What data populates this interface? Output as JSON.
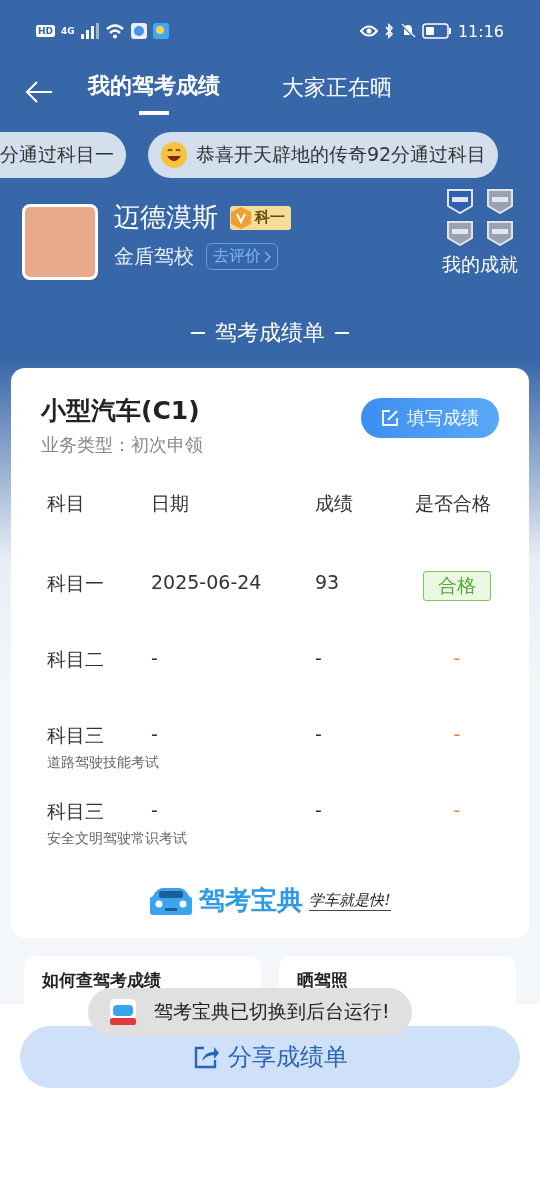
{
  "status_bar": {
    "time": "11:16",
    "hd": "HD",
    "network": "4G"
  },
  "tabs": [
    {
      "label": "我的驾考成绩",
      "selected": true
    },
    {
      "label": "大家正在晒",
      "selected": false
    }
  ],
  "ticker": [
    {
      "text": "分通过科目一",
      "emoji": false
    },
    {
      "text": "恭喜开天辟地的传奇92分通过科目",
      "emoji": true
    }
  ],
  "profile": {
    "name": "迈德漠斯",
    "badge": "科一",
    "school": "金盾驾校",
    "review_link": "去评价",
    "achievements_label": "我的成就",
    "achievements": [
      {
        "earned": true
      },
      {
        "earned": false
      },
      {
        "earned": false
      },
      {
        "earned": false
      }
    ]
  },
  "section_title": "驾考成绩单",
  "report": {
    "vehicle": "小型汽车(C1)",
    "business_type": "业务类型：初次申领",
    "fill_button": "填写成绩",
    "columns": [
      "科目",
      "日期",
      "成绩",
      "是否合格"
    ],
    "rows": [
      {
        "subject": "科目一",
        "note": "",
        "date": "2025-06-24",
        "score": "93",
        "result": "合格",
        "passed": true
      },
      {
        "subject": "科目二",
        "date": "-",
        "score": "-",
        "result": "-",
        "passed": false
      },
      {
        "subject": "科目三",
        "note": "道路驾驶技能考试",
        "date": "-",
        "score": "-",
        "result": "-",
        "passed": false
      },
      {
        "subject": "科目三",
        "note": "安全文明驾驶常识考试",
        "date": "-",
        "score": "-",
        "result": "-",
        "passed": false
      }
    ],
    "brand": "驾考宝典",
    "slogan": "学车就是快!"
  },
  "promo_cards": [
    {
      "title": "如何查驾考成绩"
    },
    {
      "title": "晒驾照"
    }
  ],
  "share_button": "分享成绩单",
  "toast": "驾考宝典已切换到后台运行!"
}
